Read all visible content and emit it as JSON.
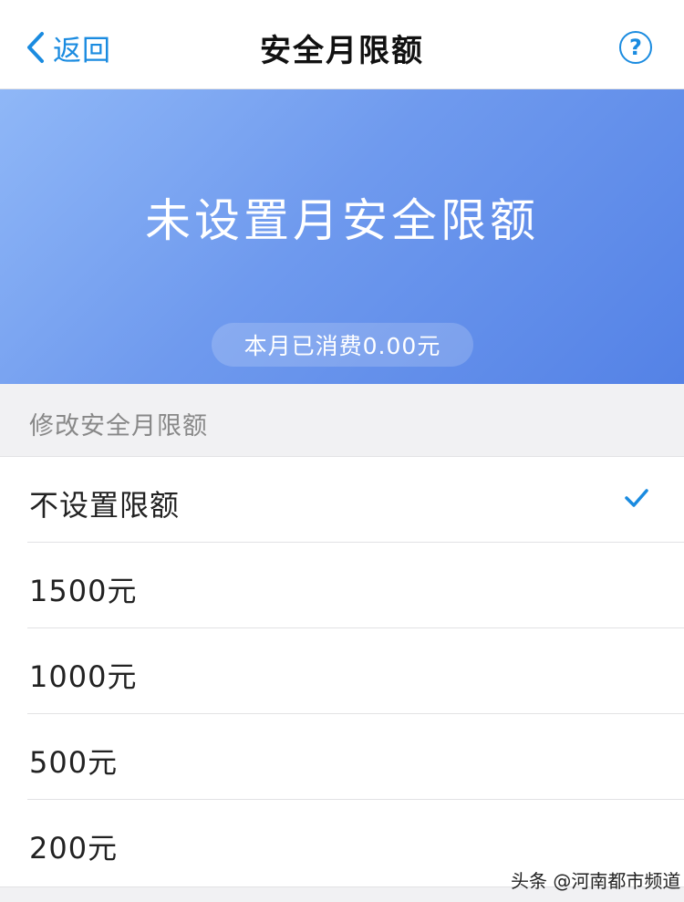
{
  "nav": {
    "back_label": "返回",
    "title": "安全月限额",
    "help_symbol": "?"
  },
  "banner": {
    "title": "未设置月安全限额",
    "spent_text": "本月已消费0.00元"
  },
  "section": {
    "header": "修改安全月限额"
  },
  "options": [
    {
      "label": "不设置限额",
      "selected": true
    },
    {
      "label": "1500元",
      "selected": false
    },
    {
      "label": "1000元",
      "selected": false
    },
    {
      "label": "500元",
      "selected": false
    },
    {
      "label": "200元",
      "selected": false
    }
  ],
  "watermark": "头条 @河南都市频道",
  "colors": {
    "accent": "#1a8be0",
    "banner_start": "#8fb7f7",
    "banner_end": "#5482e6"
  },
  "icons": {
    "back": "chevron-left-icon",
    "help": "question-circle-icon",
    "selected": "checkmark-icon"
  }
}
